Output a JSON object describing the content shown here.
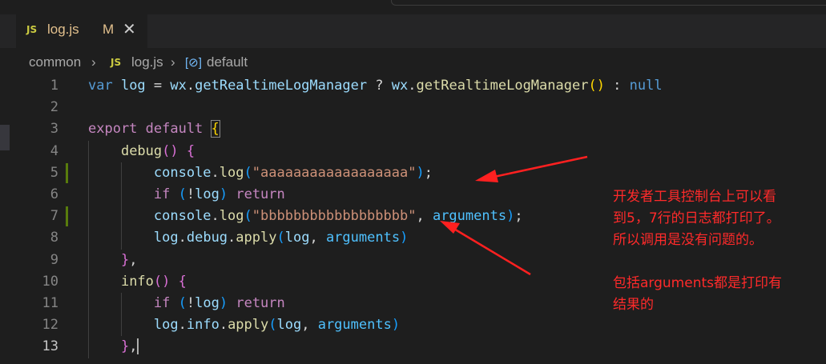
{
  "tab": {
    "icon": "JS",
    "filename": "log.js",
    "status": "M",
    "close": "✕"
  },
  "breadcrumb": {
    "folder": "common",
    "file_icon": "JS",
    "file": "log.js",
    "symbol_icon": "[⊘]",
    "symbol": "default"
  },
  "code": {
    "line_numbers": [
      "1",
      "2",
      "3",
      "4",
      "5",
      "6",
      "7",
      "8",
      "9",
      "10",
      "11",
      "12",
      "13"
    ],
    "modified_lines": [
      "5",
      "7"
    ],
    "active_line": "13",
    "lines": [
      [
        {
          "t": "var ",
          "c": "k"
        },
        {
          "t": "log",
          "c": "v"
        },
        {
          "t": " = ",
          "c": "p"
        },
        {
          "t": "wx",
          "c": "v"
        },
        {
          "t": ".",
          "c": "p"
        },
        {
          "t": "getRealtimeLogManager",
          "c": "v"
        },
        {
          "t": " ? ",
          "c": "p"
        },
        {
          "t": "wx",
          "c": "v"
        },
        {
          "t": ".",
          "c": "p"
        },
        {
          "t": "getRealtimeLogManager",
          "c": "f"
        },
        {
          "t": "()",
          "c": "br1"
        },
        {
          "t": " : ",
          "c": "p"
        },
        {
          "t": "null",
          "c": "k"
        }
      ],
      [],
      [
        {
          "t": "export default ",
          "c": "kc"
        },
        {
          "t": "{",
          "c": "br1"
        }
      ],
      [
        {
          "t": "    ",
          "c": "p"
        },
        {
          "t": "debug",
          "c": "f"
        },
        {
          "t": "()",
          "c": "br2"
        },
        {
          "t": " ",
          "c": "p"
        },
        {
          "t": "{",
          "c": "br2"
        }
      ],
      [
        {
          "t": "        ",
          "c": "p"
        },
        {
          "t": "console",
          "c": "v"
        },
        {
          "t": ".",
          "c": "p"
        },
        {
          "t": "log",
          "c": "f"
        },
        {
          "t": "(",
          "c": "br3"
        },
        {
          "t": "\"aaaaaaaaaaaaaaaaaa\"",
          "c": "s"
        },
        {
          "t": ")",
          "c": "br3"
        },
        {
          "t": ";",
          "c": "p"
        }
      ],
      [
        {
          "t": "        ",
          "c": "p"
        },
        {
          "t": "if",
          "c": "kc"
        },
        {
          "t": " ",
          "c": "p"
        },
        {
          "t": "(",
          "c": "br3"
        },
        {
          "t": "!",
          "c": "p"
        },
        {
          "t": "log",
          "c": "v"
        },
        {
          "t": ")",
          "c": "br3"
        },
        {
          "t": " ",
          "c": "p"
        },
        {
          "t": "return",
          "c": "kc"
        }
      ],
      [
        {
          "t": "        ",
          "c": "p"
        },
        {
          "t": "console",
          "c": "v"
        },
        {
          "t": ".",
          "c": "p"
        },
        {
          "t": "log",
          "c": "f"
        },
        {
          "t": "(",
          "c": "br3"
        },
        {
          "t": "\"bbbbbbbbbbbbbbbbbb\"",
          "c": "s"
        },
        {
          "t": ", ",
          "c": "p"
        },
        {
          "t": "arguments",
          "c": "ar"
        },
        {
          "t": ")",
          "c": "br3"
        },
        {
          "t": ";",
          "c": "p"
        }
      ],
      [
        {
          "t": "        ",
          "c": "p"
        },
        {
          "t": "log",
          "c": "v"
        },
        {
          "t": ".",
          "c": "p"
        },
        {
          "t": "debug",
          "c": "v"
        },
        {
          "t": ".",
          "c": "p"
        },
        {
          "t": "apply",
          "c": "f"
        },
        {
          "t": "(",
          "c": "br3"
        },
        {
          "t": "log",
          "c": "v"
        },
        {
          "t": ", ",
          "c": "p"
        },
        {
          "t": "arguments",
          "c": "ar"
        },
        {
          "t": ")",
          "c": "br3"
        }
      ],
      [
        {
          "t": "    ",
          "c": "p"
        },
        {
          "t": "}",
          "c": "br2"
        },
        {
          "t": ",",
          "c": "p"
        }
      ],
      [
        {
          "t": "    ",
          "c": "p"
        },
        {
          "t": "info",
          "c": "f"
        },
        {
          "t": "()",
          "c": "br2"
        },
        {
          "t": " ",
          "c": "p"
        },
        {
          "t": "{",
          "c": "br2"
        }
      ],
      [
        {
          "t": "        ",
          "c": "p"
        },
        {
          "t": "if",
          "c": "kc"
        },
        {
          "t": " ",
          "c": "p"
        },
        {
          "t": "(",
          "c": "br3"
        },
        {
          "t": "!",
          "c": "p"
        },
        {
          "t": "log",
          "c": "v"
        },
        {
          "t": ")",
          "c": "br3"
        },
        {
          "t": " ",
          "c": "p"
        },
        {
          "t": "return",
          "c": "kc"
        }
      ],
      [
        {
          "t": "        ",
          "c": "p"
        },
        {
          "t": "log",
          "c": "v"
        },
        {
          "t": ".",
          "c": "p"
        },
        {
          "t": "info",
          "c": "v"
        },
        {
          "t": ".",
          "c": "p"
        },
        {
          "t": "apply",
          "c": "f"
        },
        {
          "t": "(",
          "c": "br3"
        },
        {
          "t": "log",
          "c": "v"
        },
        {
          "t": ", ",
          "c": "p"
        },
        {
          "t": "arguments",
          "c": "ar"
        },
        {
          "t": ")",
          "c": "br3"
        }
      ],
      [
        {
          "t": "    ",
          "c": "p"
        },
        {
          "t": "}",
          "c": "br2"
        },
        {
          "t": ",",
          "c": "p"
        }
      ]
    ]
  },
  "annotation": {
    "lines": [
      "开发者工具控制台上可以看",
      "到5，7行的日志都打印了。",
      "所以调用是没有问题的。",
      "",
      "包括arguments都是打印有",
      "结果的"
    ],
    "color": "#ff2a2a"
  },
  "colors": {
    "editor_bg": "#1e1e1e",
    "keyword": "#569cd6",
    "control": "#c586c0",
    "string": "#ce9178",
    "function": "#dcdcaa",
    "variable": "#9cdcfe"
  }
}
